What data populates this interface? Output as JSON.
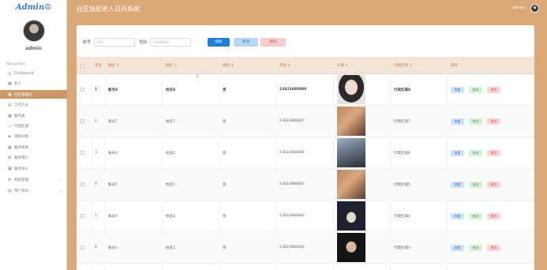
{
  "app": {
    "logo": "Admin☺",
    "title": "社区独居老人日托系统"
  },
  "header": {
    "user": "admin"
  },
  "sidebar": {
    "user": "admin",
    "nav_title": "Navigation",
    "items": [
      {
        "label": "Dashboard",
        "icon": "clock-icon"
      },
      {
        "label": "老人",
        "icon": "grid-icon"
      },
      {
        "label": "社区管理员",
        "icon": "grid-icon",
        "active": true
      },
      {
        "label": "工作人员",
        "icon": "doc-icon"
      },
      {
        "label": "服务类",
        "icon": "grid-icon"
      },
      {
        "label": "行政区域",
        "icon": "monitor-icon"
      },
      {
        "label": "项目分类",
        "icon": "shield-icon"
      },
      {
        "label": "服务项目",
        "icon": "grid-icon"
      },
      {
        "label": "服务预订",
        "icon": "car-icon"
      },
      {
        "label": "服务评价",
        "icon": "grid-icon"
      },
      {
        "label": "系统管理",
        "icon": "gear-icon",
        "has_chevron": true
      },
      {
        "label": "用户资料",
        "icon": "doc-icon",
        "has_chevron": true
      }
    ]
  },
  "search": {
    "account_label": "账号",
    "account_placeholder": "账号",
    "gender_label": "性别",
    "gender_placeholder": "请选择性别",
    "search_button": "搜索",
    "add_button": "新增",
    "delete_button": "删除"
  },
  "table": {
    "columns": [
      "序号",
      "账号",
      "姓名",
      "性别",
      "电话",
      "头像",
      "行政区域",
      "操作"
    ],
    "actions": {
      "view": "查看",
      "edit": "修改",
      "delete": "删除"
    },
    "rows": [
      {
        "index": "1",
        "account": "账号8",
        "name": "姓名8",
        "gender": "男",
        "phone": "13823888888",
        "region": "行政区域8"
      },
      {
        "index": "2",
        "account": "账号7",
        "name": "姓名7",
        "gender": "男",
        "phone": "13823888887",
        "region": "行政区域7"
      },
      {
        "index": "3",
        "account": "账号6",
        "name": "姓名6",
        "gender": "男",
        "phone": "13823888886",
        "region": "行政区域6"
      },
      {
        "index": "4",
        "account": "账号5",
        "name": "姓名5",
        "gender": "男",
        "phone": "13823888885",
        "region": "行政区域5"
      },
      {
        "index": "5",
        "account": "账号4",
        "name": "姓名4",
        "gender": "男",
        "phone": "13823888884",
        "region": "行政区域4"
      },
      {
        "index": "6",
        "account": "账号3",
        "name": "姓名3",
        "gender": "男",
        "phone": "13823888883",
        "region": "行政区域3"
      }
    ]
  },
  "colors": {
    "accent": "#dba878",
    "active_nav": "#cc9966",
    "primary": "#1a7fe0"
  }
}
